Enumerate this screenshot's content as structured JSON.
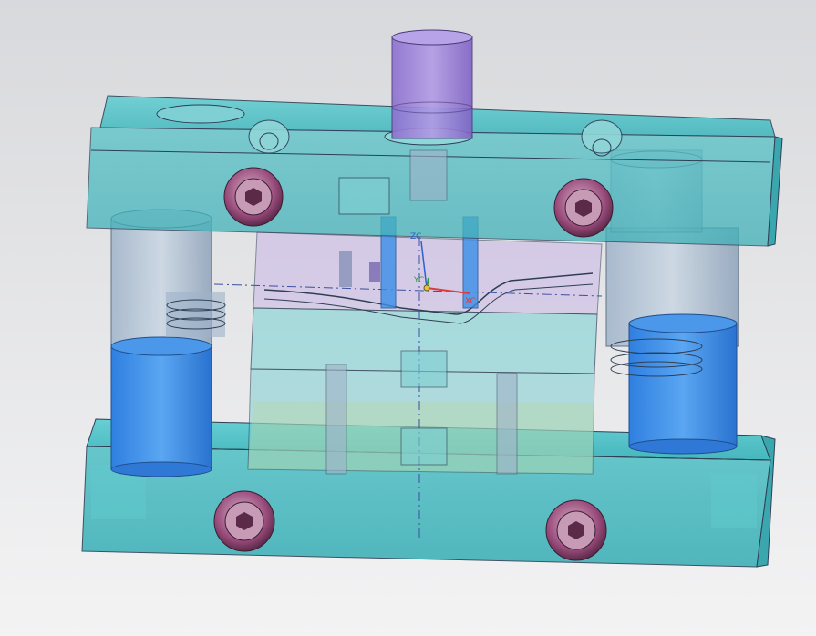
{
  "viewport": {
    "background_top": "#d8d9dc",
    "background_bottom": "#f3f3f4"
  },
  "model": {
    "plate_color": "#4fc3c8",
    "punch_color": "#9b7fd6",
    "guide_pillar_color": "#3a8fe8",
    "bolt_color": "#b24a8a",
    "edge_color": "#2e3f55"
  },
  "wcs_triad": {
    "z_label": "ZC",
    "y_label": "YC",
    "x_label": "XC",
    "z_color": "#2f5fd0",
    "y_color": "#2e9a3a",
    "x_color": "#e03a3a"
  }
}
